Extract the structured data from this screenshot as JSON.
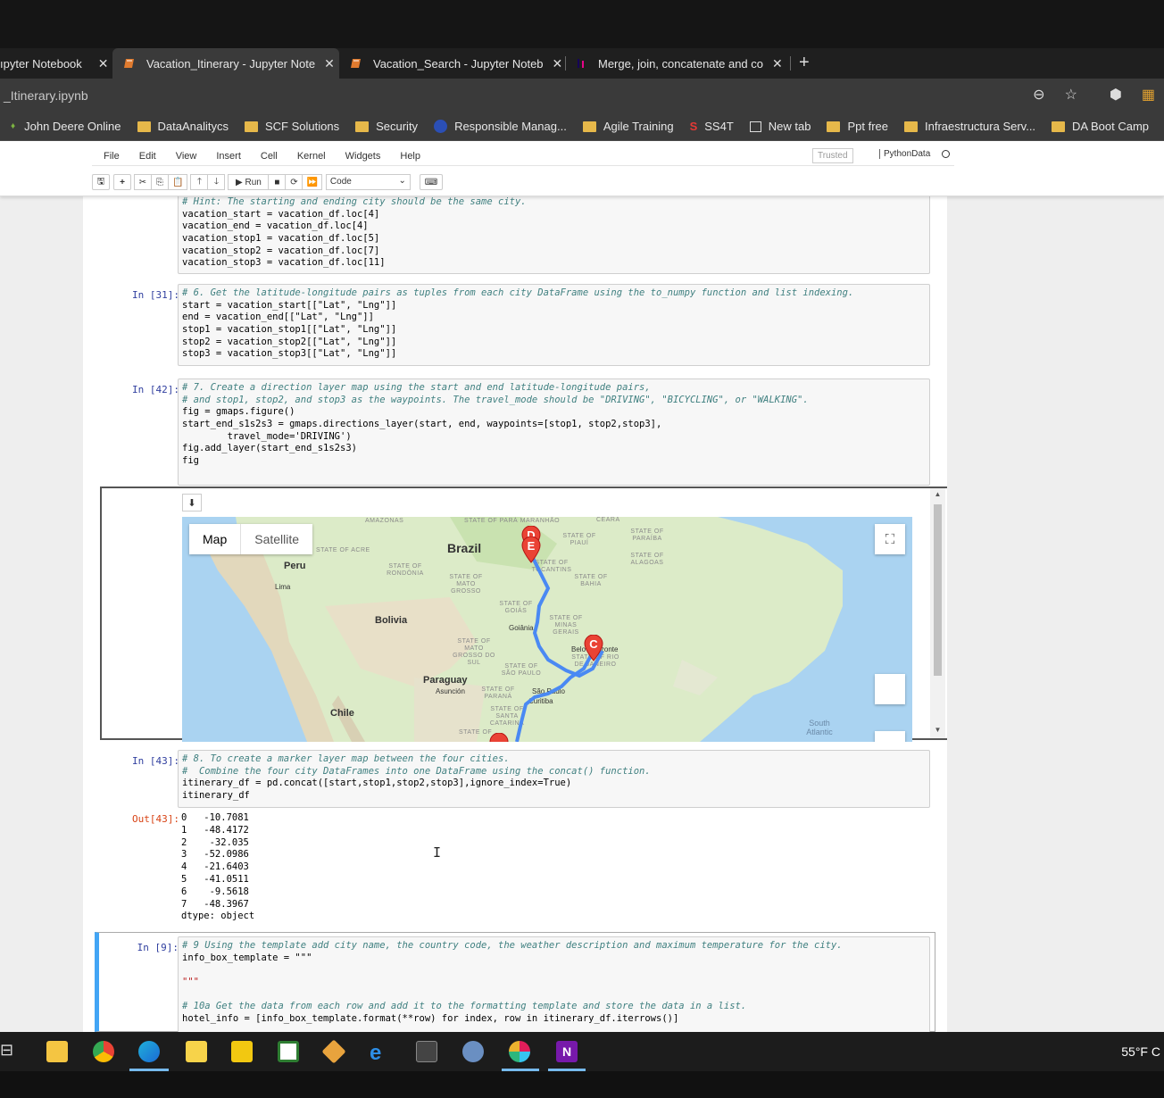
{
  "browser": {
    "tabs": [
      {
        "title": "ıpyter Notebook",
        "close": "✕"
      },
      {
        "title": "Vacation_Itinerary - Jupyter Note",
        "close": "✕"
      },
      {
        "title": "Vacation_Search - Jupyter Noteb",
        "close": "✕"
      },
      {
        "title": "Merge, join, concatenate and co",
        "close": "✕"
      }
    ],
    "new_tab": "+",
    "address": "_Itinerary.ipynb",
    "bookmarks": [
      "John Deere Online",
      "DataAnalitycs",
      "SCF Solutions",
      "Security",
      "Responsible Manag...",
      "Agile Training",
      "SS4T",
      "New tab",
      "Ppt free",
      "Infraestructura Serv...",
      "DA Boot Camp"
    ]
  },
  "jupyter": {
    "menu": [
      "File",
      "Edit",
      "View",
      "Insert",
      "Cell",
      "Kernel",
      "Widgets",
      "Help"
    ],
    "trusted": "Trusted",
    "kernel": "PythonData",
    "toolbar": {
      "run": "▶ Run",
      "cell_type": "Code"
    }
  },
  "cells": {
    "c0": {
      "lines": [
        "# Hint: The starting and ending city should be the same city.",
        "vacation_start = vacation_df.loc[4]",
        "vacation_end = vacation_df.loc[4]",
        "vacation_stop1 = vacation_df.loc[5]",
        "vacation_stop2 = vacation_df.loc[7]",
        "vacation_stop3 = vacation_df.loc[11]"
      ]
    },
    "c31": {
      "prompt": "In [31]:",
      "lines": [
        "# 6. Get the latitude-longitude pairs as tuples from each city DataFrame using the to_numpy function and list indexing.",
        "start = vacation_start[[\"Lat\", \"Lng\"]]",
        "end = vacation_end[[\"Lat\", \"Lng\"]]",
        "stop1 = vacation_stop1[[\"Lat\", \"Lng\"]]",
        "stop2 = vacation_stop2[[\"Lat\", \"Lng\"]]",
        "stop3 = vacation_stop3[[\"Lat\", \"Lng\"]]"
      ]
    },
    "c42": {
      "prompt": "In [42]:",
      "lines": [
        "# 7. Create a direction layer map using the start and end latitude-longitude pairs,",
        "# and stop1, stop2, and stop3 as the waypoints. The travel_mode should be \"DRIVING\", \"BICYCLING\", or \"WALKING\".",
        "fig = gmaps.figure()",
        "start_end_s1s2s3 = gmaps.directions_layer(start, end, waypoints=[stop1, stop2,stop3],",
        "        travel_mode='DRIVING')",
        "fig.add_layer(start_end_s1s2s3)",
        "fig"
      ]
    },
    "c43": {
      "prompt": "In [43]:",
      "out_prompt": "Out[43]:",
      "lines": [
        "# 8. To create a marker layer map between the four cities.",
        "#  Combine the four city DataFrames into one DataFrame using the concat() function.",
        "itinerary_df = pd.concat([start,stop1,stop2,stop3],ignore_index=True)",
        "itinerary_df"
      ],
      "output": [
        "0   -10.7081",
        "1   -48.4172",
        "2    -32.035",
        "3   -52.0986",
        "4   -21.6403",
        "5   -41.0511",
        "6    -9.5618",
        "7   -48.3967",
        "dtype: object"
      ]
    },
    "c9": {
      "prompt": "In [9]:",
      "lines": [
        "# 9 Using the template add city name, the country code, the weather description and maximum temperature for the city.",
        "info_box_template = \"\"\"",
        "",
        "\"\"\"",
        "",
        "",
        "# 10a Get the data from each row and add it to the formatting template and store the data in a list.",
        "hotel_info = [info_box_template.format(**row) for index, row in itinerary_df.iterrows()]"
      ]
    }
  },
  "map": {
    "map_btn": "Map",
    "satellite_btn": "Satellite",
    "download": "⬇",
    "fullscreen": "⛶",
    "labels": {
      "brazil": "Brazil",
      "peru": "Peru",
      "lima": "Lima",
      "bolivia": "Bolivia",
      "paraguay": "Paraguay",
      "asuncion": "Asunción",
      "chile": "Chile",
      "amazonas": "AMAZONAS",
      "para_maranhao": "STATE OF PARÁ MARANHÃO",
      "ceara": "CEARÁ",
      "piaui": "STATE OF PIAUÍ",
      "paraiba": "STATE OF PARAÍBA",
      "alagoas": "STATE OF ALAGOAS",
      "acre": "STATE OF ACRE",
      "rondonia": "STATE OF RONDÔNIA",
      "mato_grosso": "STATE OF MATO GROSSO",
      "tocantins": "STATE OF TOCANTINS",
      "bahia": "STATE OF BAHIA",
      "goias": "STATE OF GOIÁS",
      "goiania": "Goiânia",
      "minas": "STATE OF MINAS GERAIS",
      "mgs": "STATE OF MATO GROSSO DO SUL",
      "bh": "Belo Horizonte",
      "rio": "STATE OF RIO DE JANEIRO",
      "sp_state": "STATE OF SÃO PAULO",
      "sao_paulo": "São Paulo",
      "parana": "STATE OF PARANÁ",
      "curitiba": "Curitiba",
      "sc": "STATE OF SANTA CATARINA",
      "rs": "STATE OF",
      "south_atlantic": "South Atlantic"
    },
    "markers": [
      "D",
      "E",
      "C"
    ]
  },
  "taskbar": {
    "temperature": "55°F C"
  }
}
